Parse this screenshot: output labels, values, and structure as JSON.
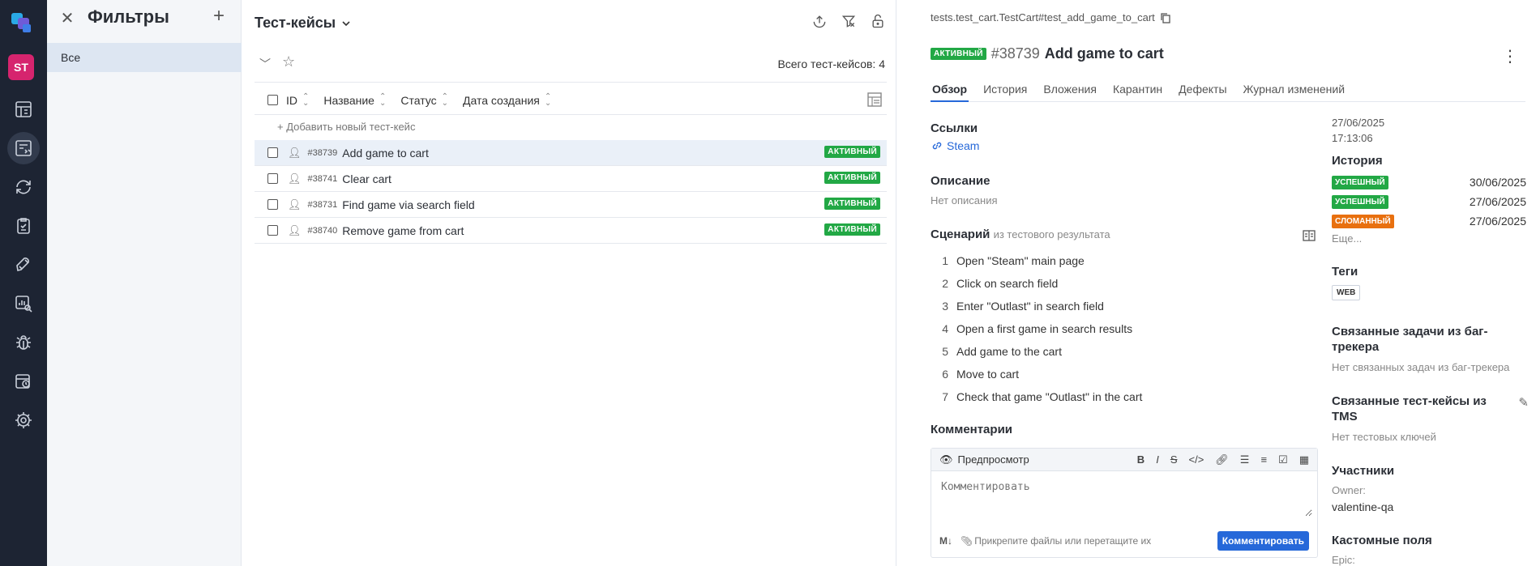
{
  "rail": {
    "avatar": "ST",
    "colors": {
      "bg": "#1d2433",
      "avatar": "#d6246e"
    },
    "icons": [
      "logo-icon",
      "dashboard-icon",
      "test-cases-icon",
      "launches-icon",
      "checklist-icon",
      "rocket-icon",
      "analytics-icon",
      "bug-icon",
      "jobs-icon",
      "settings-icon"
    ]
  },
  "filters": {
    "title": "Фильтры",
    "items": [
      "Все"
    ]
  },
  "list": {
    "title": "Тест-кейсы",
    "total": "Всего тест-кейсов: 4",
    "columns": [
      "ID",
      "Название",
      "Статус",
      "Дата создания"
    ],
    "add_label": "+ Добавить новый тест-кейс",
    "rows": [
      {
        "id": "#38739",
        "name": "Add game to cart",
        "status": "АКТИВНЫЙ"
      },
      {
        "id": "#38741",
        "name": "Clear cart",
        "status": "АКТИВНЫЙ"
      },
      {
        "id": "#38731",
        "name": "Find game via search field",
        "status": "АКТИВНЫЙ"
      },
      {
        "id": "#38740",
        "name": "Remove game from cart",
        "status": "АКТИВНЫЙ"
      }
    ]
  },
  "detail": {
    "path": "tests.test_cart.TestCart#test_add_game_to_cart",
    "status": "АКТИВНЫЙ",
    "number": "#38739",
    "name": "Add game to cart",
    "tabs": [
      "Обзор",
      "История",
      "Вложения",
      "Карантин",
      "Дефекты",
      "Журнал изменений"
    ],
    "links_title": "Ссылки",
    "link": "Steam",
    "desc_title": "Описание",
    "desc": "Нет описания",
    "scenario_title": "Сценарий",
    "scenario_sub": "из тестового результата",
    "steps": [
      "Open \"Steam\" main page",
      "Click on search field",
      "Enter \"Outlast\" in search field",
      "Open a first game in search results",
      "Add game to the cart",
      "Move to cart",
      "Check that game \"Outlast\" in the cart"
    ],
    "comments_title": "Комментарии",
    "preview": "Предпросмотр",
    "comment_placeholder": "Комментировать",
    "attach": "Прикрепите файлы или перетащите их",
    "comment_btn": "Комментировать"
  },
  "right": {
    "date": "27/06/2025",
    "time": "17:13:06",
    "history_title": "История",
    "history": [
      {
        "status": "УСПЕШНЫЙ",
        "color": "#22a845",
        "date": "30/06/2025"
      },
      {
        "status": "УСПЕШНЫЙ",
        "color": "#22a845",
        "date": "27/06/2025"
      },
      {
        "status": "СЛОМАННЫЙ",
        "color": "#e8700f",
        "date": "27/06/2025"
      }
    ],
    "more": "Еще...",
    "tags_title": "Теги",
    "tag": "WEB",
    "issues_title": "Связанные задачи из баг-трекера",
    "issues_empty": "Нет связанных задач из баг-трекера",
    "tms_title": "Связанные тест-кейсы из TMS",
    "tms_empty": "Нет тестовых ключей",
    "members_title": "Участники",
    "owner_label": "Owner:",
    "owner": "valentine-qa",
    "custom_title": "Кастомные поля",
    "epic_label": "Epic:"
  }
}
